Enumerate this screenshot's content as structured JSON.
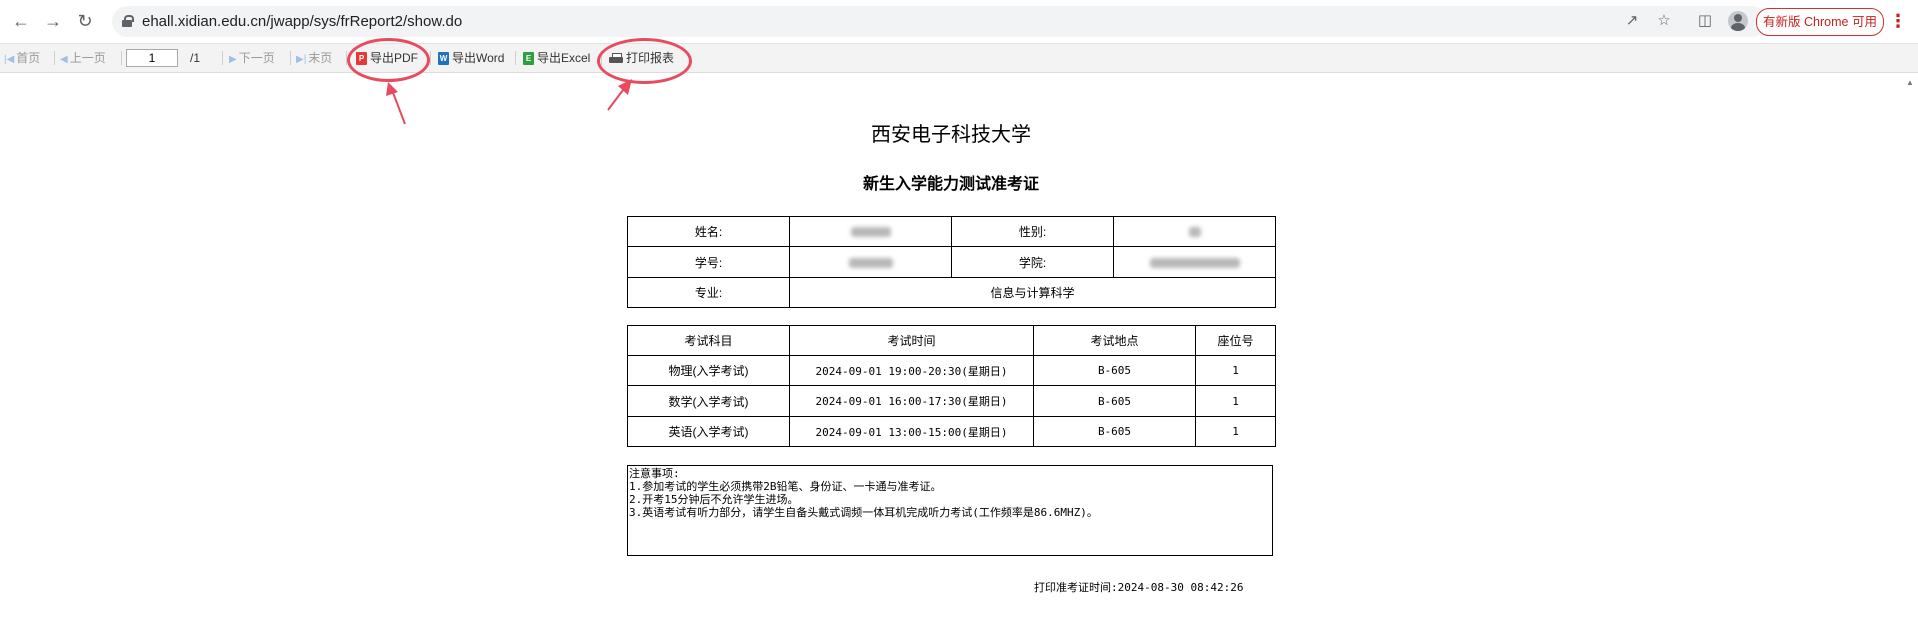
{
  "browser": {
    "url": "ehall.xidian.edu.cn/jwapp/sys/frReport2/show.do",
    "update_button": "有新版 Chrome 可用",
    "icons": {
      "back": "arrow-left-icon",
      "forward": "arrow-right-icon",
      "reload": "reload-icon",
      "lock": "lock-icon",
      "share": "share-icon",
      "bookmark": "star-icon",
      "side_panel": "side-panel-icon",
      "profile": "avatar-icon",
      "menu": "kebab-menu-icon"
    }
  },
  "toolbar": {
    "first_page": "首页",
    "prev_page": "上一页",
    "page_number": "1",
    "page_total": "/1",
    "next_page": "下一页",
    "last_page": "末页",
    "export_pdf": "导出PDF",
    "export_word": "导出Word",
    "export_excel": "导出Excel",
    "print_report": "打印报表",
    "badges": {
      "pdf": "P",
      "word": "W",
      "excel": "E"
    },
    "colors": {
      "pdf": "#e53935",
      "word": "#1e73be",
      "excel": "#2e9e3f",
      "annotation": "#e84a5f"
    }
  },
  "report": {
    "university": "西安电子科技大学",
    "title": "新生入学能力测试准考证",
    "student": {
      "name_label": "姓名:",
      "gender_label": "性别:",
      "id_label": "学号:",
      "college_label": "学院:",
      "major_label": "专业:",
      "major_value": "信息与计算科学"
    },
    "exam_table": {
      "headers": [
        "考试科目",
        "考试时间",
        "考试地点",
        "座位号"
      ],
      "rows": [
        {
          "subject": "物理(入学考试)",
          "time": "2024-09-01 19:00-20:30(星期日)",
          "location": "B-605",
          "seat": "1"
        },
        {
          "subject": "数学(入学考试)",
          "time": "2024-09-01 16:00-17:30(星期日)",
          "location": "B-605",
          "seat": "1"
        },
        {
          "subject": "英语(入学考试)",
          "time": "2024-09-01 13:00-15:00(星期日)",
          "location": "B-605",
          "seat": "1"
        }
      ]
    },
    "notes": {
      "heading": "注意事项:",
      "items": [
        "1.参加考试的学生必须携带2B铅笔、身份证、一卡通与准考证。",
        "2.开考15分钟后不允许学生进场。",
        "3.英语考试有听力部分，请学生自备头戴式调频一体耳机完成听力考试(工作频率是86.6MHZ)。"
      ]
    },
    "print_time_label": "打印准考证时间:",
    "print_time_value": "2024-08-30 08:42:26"
  }
}
